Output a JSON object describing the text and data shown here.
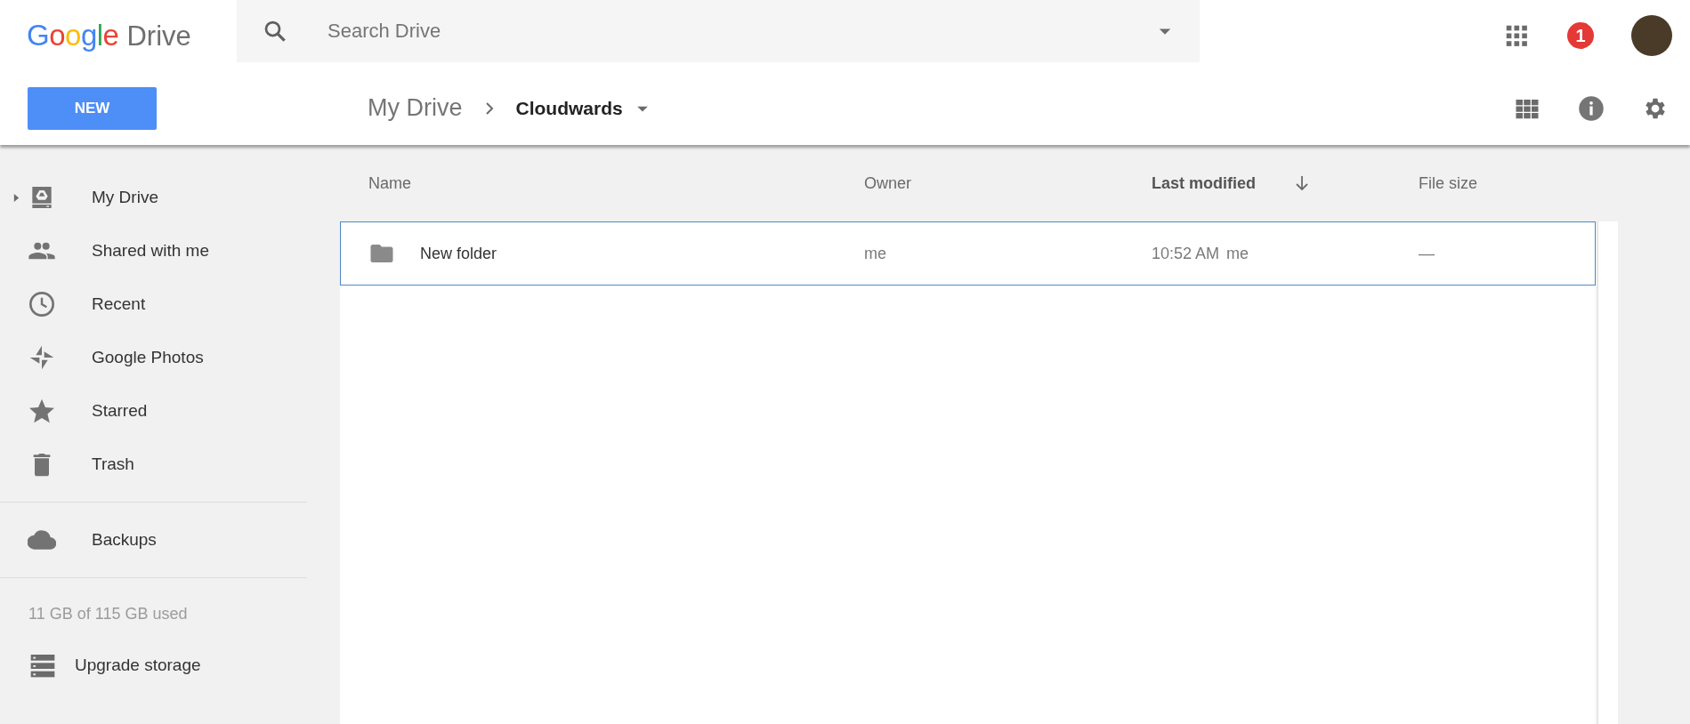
{
  "header": {
    "logo": {
      "brand": "Google",
      "product": "Drive"
    },
    "search": {
      "placeholder": "Search Drive"
    },
    "notifications": {
      "count": "1"
    }
  },
  "toolbar": {
    "new_button": "NEW",
    "breadcrumb": [
      {
        "label": "My Drive",
        "current": false
      },
      {
        "label": "Cloudwards",
        "current": true
      }
    ]
  },
  "sidebar": {
    "items": [
      {
        "label": "My Drive",
        "kind": "drive",
        "expandable": true
      },
      {
        "label": "Shared with me",
        "kind": "people",
        "expandable": false
      },
      {
        "label": "Recent",
        "kind": "clock",
        "expandable": false
      },
      {
        "label": "Google Photos",
        "kind": "pinwheel",
        "expandable": false
      },
      {
        "label": "Starred",
        "kind": "star",
        "expandable": false
      },
      {
        "label": "Trash",
        "kind": "trash",
        "expandable": false
      },
      {
        "label": "Backups",
        "kind": "cloud",
        "expandable": false
      }
    ],
    "storage": "11 GB of 115 GB used",
    "upgrade": "Upgrade storage"
  },
  "table": {
    "columns": [
      {
        "label": "Name",
        "sorted": false
      },
      {
        "label": "Owner",
        "sorted": false
      },
      {
        "label": "Last modified",
        "sorted": true
      },
      {
        "label": "File size",
        "sorted": false
      }
    ],
    "rows": [
      {
        "name": "New folder",
        "owner": "me",
        "modified": "10:52 AM",
        "modified_by": "me",
        "size": "—",
        "selected": true
      }
    ]
  }
}
